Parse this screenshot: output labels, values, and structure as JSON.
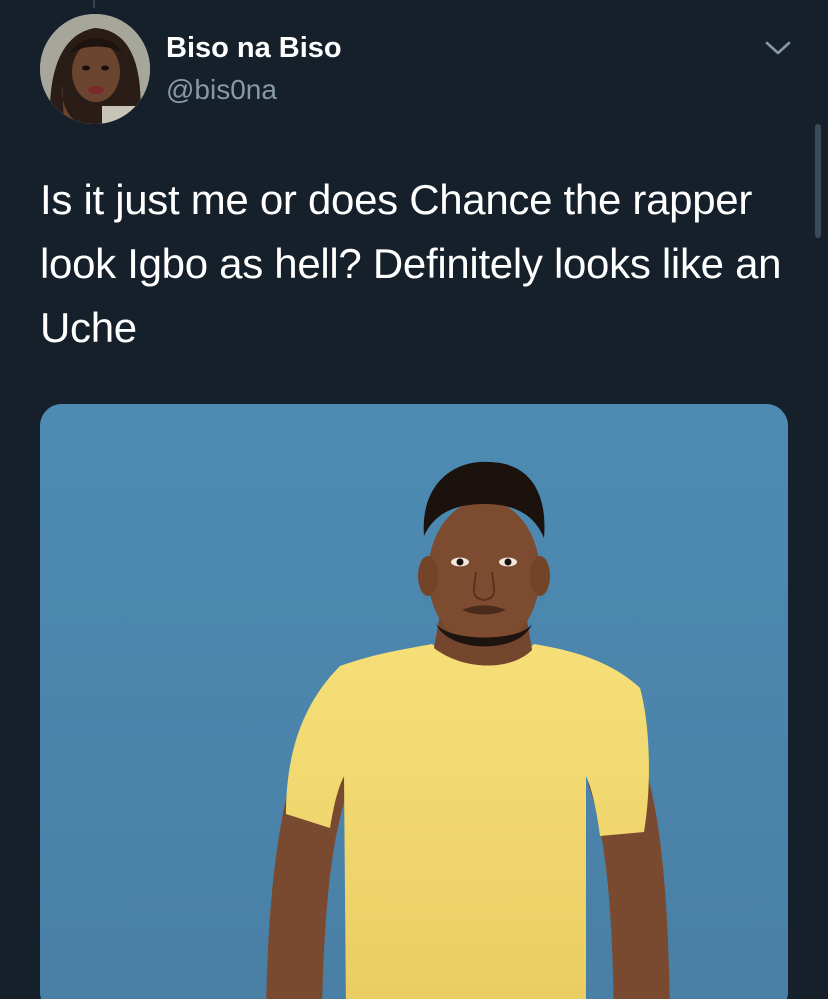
{
  "tweet": {
    "author": {
      "display_name": "Biso na Biso",
      "handle": "@bis0na"
    },
    "text": "Is it just me or does Chance the rapper look Igbo as hell? Definitely looks like an Uche"
  },
  "icons": {
    "menu": "chevron-down-icon"
  },
  "colors": {
    "background": "#15202b",
    "secondary_text": "#8899a6",
    "media_background": "#4b86ad"
  }
}
